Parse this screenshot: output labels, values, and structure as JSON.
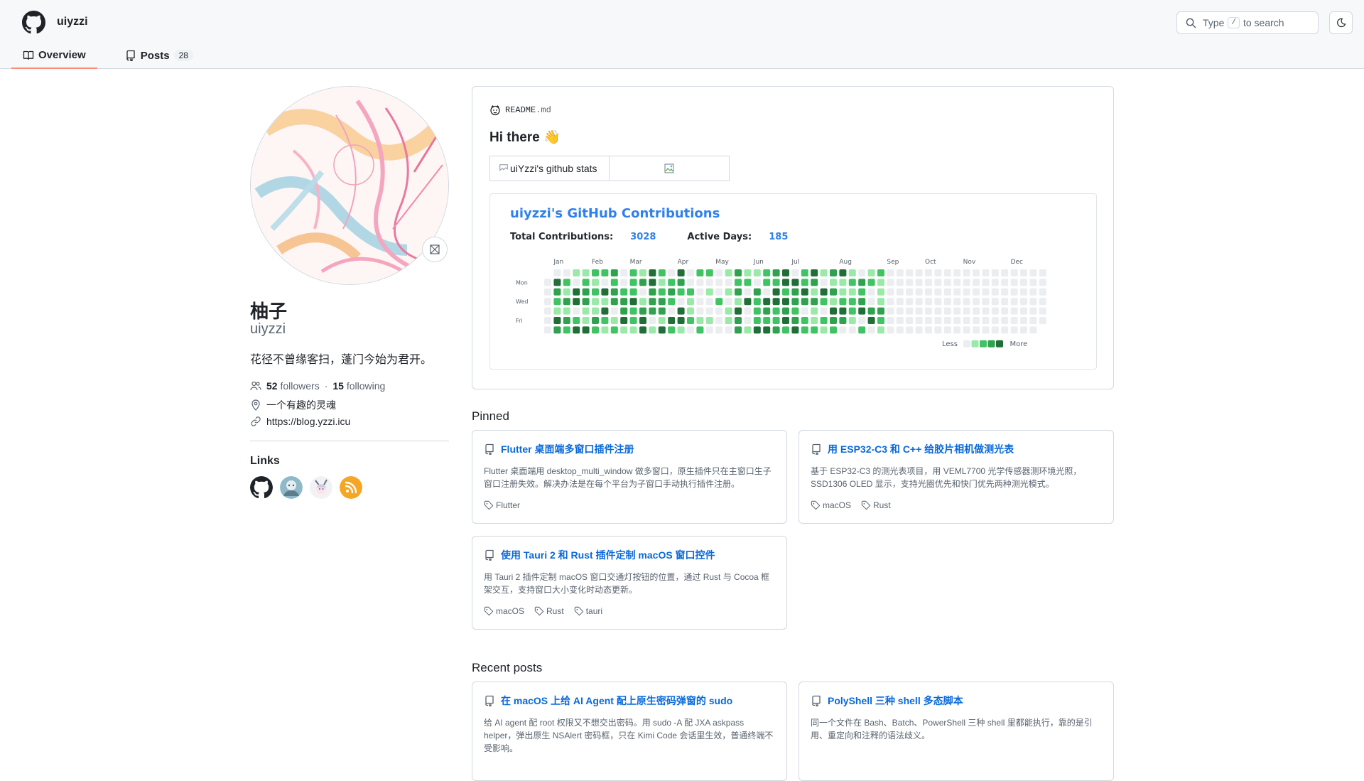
{
  "header": {
    "brand": "uiyzzi",
    "search": {
      "prefix": "Type",
      "key": "/",
      "suffix": "to search"
    },
    "tabs": [
      {
        "label": "Overview",
        "icon": "book-icon",
        "active": true
      },
      {
        "label": "Posts",
        "icon": "repo-icon",
        "count": "28"
      }
    ]
  },
  "profile": {
    "name": "柚子",
    "login": "uiyzzi",
    "bio": "花径不曾缘客扫，蓬门今始为君开。",
    "followers_count": "52",
    "followers_label": "followers",
    "following_count": "15",
    "following_label": "following",
    "separator": "·",
    "location": "一个有趣的灵魂",
    "website": "https://blog.yzzi.icu",
    "links_title": "Links",
    "links": [
      "github-icon",
      "avatar-link-1",
      "avatar-link-2",
      "rss-icon"
    ]
  },
  "readme": {
    "file_name": "README",
    "file_ext": ".md",
    "heading": "Hi there 👋",
    "stats_alt": "uiYzzi's github stats",
    "contrib": {
      "title": "uiyzzi's GitHub Contributions",
      "total_label": "Total Contributions:",
      "total_value": "3028",
      "active_label": "Active Days:",
      "active_value": "185",
      "months": [
        "Jan",
        "Feb",
        "Mar",
        "Apr",
        "May",
        "Jun",
        "Jul",
        "Aug",
        "Sep",
        "Oct",
        "Nov",
        "Dec"
      ],
      "days": [
        "Mon",
        "Wed",
        "Fri"
      ],
      "less": "Less",
      "more": "More",
      "colors": [
        "#ebedf0",
        "#9be9a8",
        "#40c463",
        "#30a14e",
        "#216e39"
      ]
    }
  },
  "pinned": {
    "title": "Pinned",
    "items": [
      {
        "title": "Flutter 桌面端多窗口插件注册",
        "desc": "Flutter 桌面端用 desktop_multi_window 做多窗口，原生插件只在主窗口生子窗口注册失效。解决办法是在每个平台为子窗口手动执行插件注册。",
        "tags": [
          "Flutter"
        ]
      },
      {
        "title": "用 ESP32-C3 和 C++ 给胶片相机做测光表",
        "desc": "基于 ESP32-C3 的测光表项目，用 VEML7700 光学传感器测环境光照，SSD1306 OLED 显示，支持光圈优先和快门优先两种测光模式。",
        "tags": [
          "macOS",
          "Rust"
        ]
      },
      {
        "title": "使用 Tauri 2 和 Rust 插件定制 macOS 窗口控件",
        "desc": "用 Tauri 2 插件定制 macOS 窗口交通灯按钮的位置，通过 Rust 与 Cocoa 框架交互，支持窗口大小变化时动态更新。",
        "tags": [
          "macOS",
          "Rust",
          "tauri"
        ]
      }
    ]
  },
  "recent": {
    "title": "Recent posts",
    "items": [
      {
        "title": "在 macOS 上给 AI Agent 配上原生密码弹窗的 sudo",
        "desc": "给 AI agent 配 root 权限又不想交出密码。用 sudo -A 配 JXA askpass helper，弹出原生 NSAlert 密码框，只在 Kimi Code 会话里生效，普通终端不受影响。"
      },
      {
        "title": "PolyShell 三种 shell 多态脚本",
        "desc": "同一个文件在 Bash、Batch、PowerShell 三种 shell 里都能执行，靠的是引用、重定向和注释的语法歧义。"
      }
    ]
  }
}
